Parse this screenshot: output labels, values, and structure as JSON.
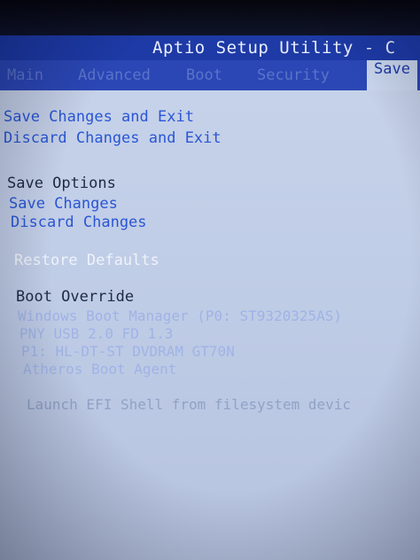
{
  "header": {
    "title": "Aptio Setup Utility - C"
  },
  "tabs": [
    {
      "label": "Main"
    },
    {
      "label": "Advanced"
    },
    {
      "label": "Boot"
    },
    {
      "label": "Security"
    },
    {
      "label": "Save",
      "active": true
    }
  ],
  "save_menu": {
    "save_changes_and_exit": "Save Changes and Exit",
    "discard_changes_and_exit": "Discard Changes and Exit",
    "save_options_heading": "Save Options",
    "save_changes": "Save Changes",
    "discard_changes": "Discard Changes",
    "restore_defaults": "Restore Defaults",
    "boot_override_heading": "Boot Override",
    "boot_override_items": [
      "Windows Boot Manager (P0: ST9320325AS)",
      "PNY USB 2.0 FD 1.3",
      "P1: HL-DT-ST DVDRAM GT70N",
      "Atheros Boot Agent"
    ],
    "launch_efi_shell": "Launch EFI Shell from filesystem devic"
  },
  "colors": {
    "header_bg": "#1d3aa6",
    "panel_bg": "#c6d2e9",
    "option_text": "#2a56d4",
    "heading_text": "#1e2a44"
  }
}
